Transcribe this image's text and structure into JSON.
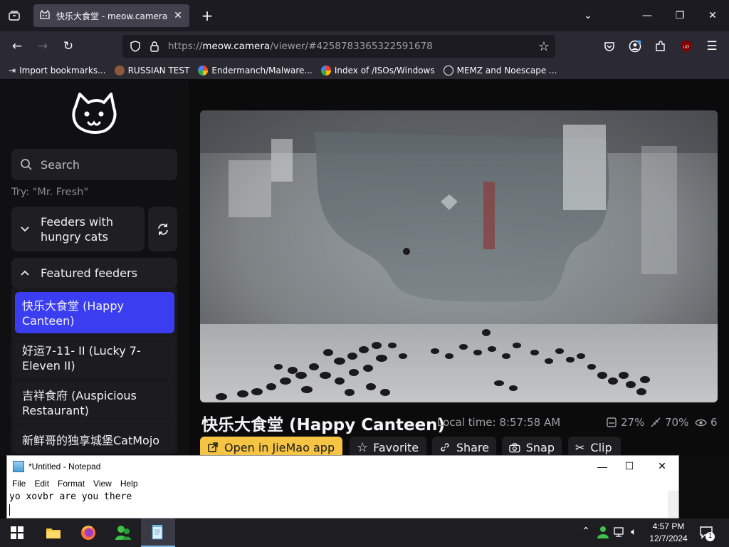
{
  "browser": {
    "tab_title": "快乐大食堂 - meow.camera",
    "url_prefix": "https://",
    "url_host": "meow.camera",
    "url_rest": "/viewer/#4258783365322591678",
    "bookmarks": [
      "Import bookmarks...",
      "RUSSIAN TEST",
      "Endermanch/Malware...",
      "Index of /ISOs/Windows",
      "MEMZ and Noescape ..."
    ]
  },
  "sidebar": {
    "search_placeholder": "Search",
    "try_hint": "Try: \"Mr. Fresh\"",
    "hungry_section": "Feeders with hungry cats",
    "featured_section": "Featured feeders",
    "feeders": [
      "快乐大食堂 (Happy Canteen)",
      "好运7-11- II (Lucky 7-Eleven II)",
      "吉祥食府 (Auspicious Restaurant)",
      "新鲜哥的独享城堡CatMojo"
    ]
  },
  "viewer": {
    "title": "快乐大食堂 (Happy Canteen)",
    "local_time": "Local time: 8:57:58 AM",
    "food_level": "27%",
    "fill_level": "70%",
    "viewers": "6",
    "buttons": {
      "open_app": "Open in JieMao app",
      "favorite": "Favorite",
      "share": "Share",
      "snap": "Snap",
      "clip": "Clip"
    }
  },
  "notepad": {
    "title": "*Untitled - Notepad",
    "menu": [
      "File",
      "Edit",
      "Format",
      "View",
      "Help"
    ],
    "text": "yo xovbr are you there"
  },
  "taskbar": {
    "time": "4:57 PM",
    "date": "12/7/2024",
    "notification_count": "1"
  },
  "colors": {
    "accent_blue": "#3b3ef0",
    "primary_yellow": "#f6c443"
  }
}
